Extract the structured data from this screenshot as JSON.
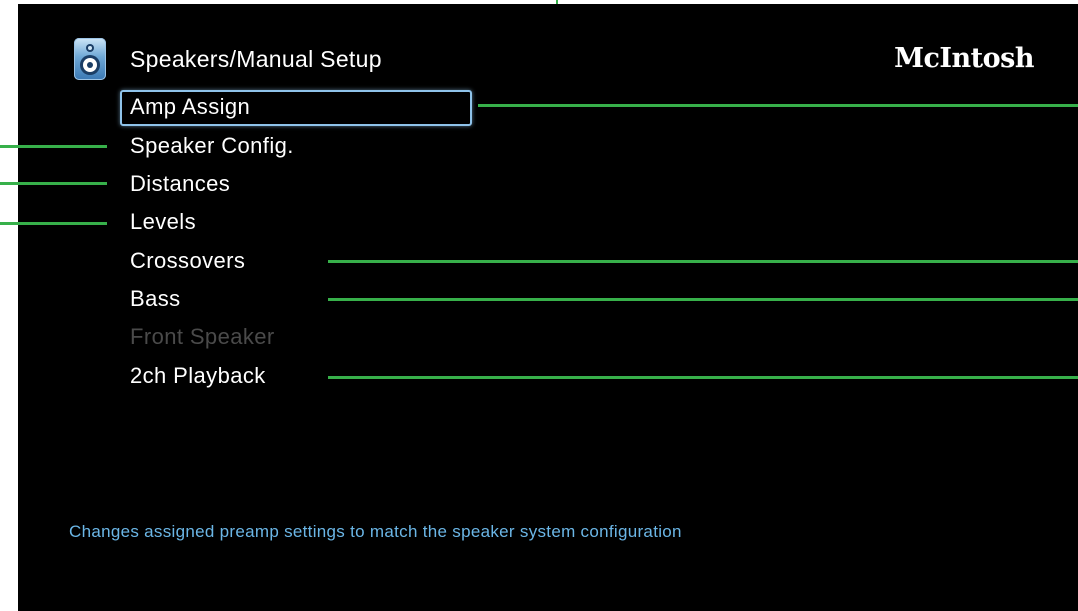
{
  "header": {
    "title": "Speakers/Manual Setup",
    "brand": "McIntosh",
    "icon": "speaker-icon"
  },
  "menu": {
    "items": [
      {
        "label": "Amp Assign",
        "state": "selected"
      },
      {
        "label": "Speaker Config.",
        "state": "enabled"
      },
      {
        "label": "Distances",
        "state": "enabled"
      },
      {
        "label": "Levels",
        "state": "enabled"
      },
      {
        "label": "Crossovers",
        "state": "enabled"
      },
      {
        "label": "Bass",
        "state": "enabled"
      },
      {
        "label": "Front Speaker",
        "state": "disabled"
      },
      {
        "label": "2ch Playback",
        "state": "enabled"
      }
    ]
  },
  "status": {
    "hint": "Changes assigned preamp settings to match the speaker system configuration"
  },
  "colors": {
    "background": "#000000",
    "text": "#ffffff",
    "disabled_text": "#4a4a4a",
    "hint_text": "#6bb6e6",
    "selection_border": "#8fc3ea",
    "callout_line": "#37b04a"
  }
}
